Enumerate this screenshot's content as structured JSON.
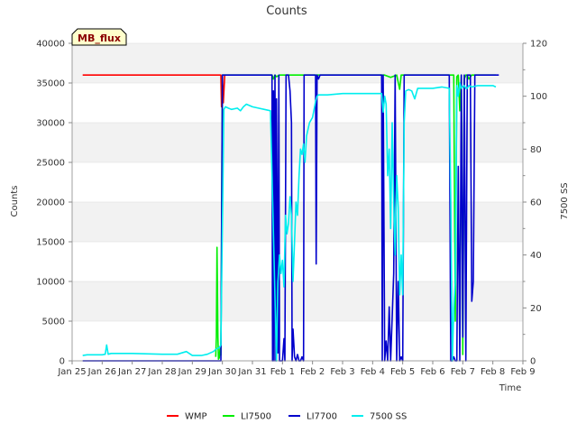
{
  "chart_data": {
    "type": "line",
    "title": "Counts",
    "xlabel": "Time",
    "ylabel": "Counts",
    "y2label": "7500 SS",
    "site_tag": "MB_flux",
    "x_ticks": [
      "Jan 25",
      "Jan 26",
      "Jan 27",
      "Jan 28",
      "Jan 29",
      "Jan 30",
      "Jan 31",
      "Feb 1",
      "Feb 2",
      "Feb 3",
      "Feb 4",
      "Feb 5",
      "Feb 6",
      "Feb 7",
      "Feb 8",
      "Feb 9"
    ],
    "xlim": [
      0,
      15
    ],
    "ylim": [
      0,
      40000
    ],
    "y_ticks": [
      0,
      5000,
      10000,
      15000,
      20000,
      25000,
      30000,
      35000,
      40000
    ],
    "y2lim": [
      0,
      120
    ],
    "y2_ticks": [
      0,
      20,
      40,
      60,
      80,
      100,
      120
    ],
    "legend_position": "bottom",
    "colors": {
      "band": "#f2f2f2",
      "grid": "#dcdcdc",
      "axis": "#888888"
    },
    "series": [
      {
        "name": "WMP",
        "color": "#ff0000",
        "axis": "left",
        "x": [
          0.35,
          4.95,
          4.97,
          5.0,
          5.03,
          5.08
        ],
        "y": [
          36000,
          36000,
          32000,
          36000,
          32500,
          36000
        ]
      },
      {
        "name": "LI7500",
        "color": "#00ee00",
        "axis": "left",
        "x": [
          4.78,
          4.8,
          4.82,
          4.85,
          4.87,
          4.9,
          4.92,
          4.95,
          5.0,
          5.05,
          5.1,
          6.65,
          6.7,
          6.75,
          6.8,
          6.9,
          7.2,
          10.4,
          10.6,
          10.8,
          10.9,
          10.95,
          11.0,
          12.7,
          12.75,
          12.8,
          12.85,
          12.9,
          12.95,
          13.0,
          13.05,
          13.1,
          13.15,
          13.2,
          13.3,
          13.5,
          14.1
        ],
        "y": [
          500,
          3000,
          14300,
          3000,
          200,
          400,
          1500,
          700,
          36000,
          36000,
          36000,
          36000,
          35500,
          36000,
          35800,
          36000,
          36000,
          36000,
          35700,
          36000,
          34200,
          36000,
          36000,
          36000,
          5000,
          35800,
          36000,
          31500,
          36000,
          800,
          35500,
          36000,
          36000,
          35500,
          36000,
          36000,
          36000
        ]
      },
      {
        "name": "LI7700",
        "color": "#0000cc",
        "axis": "left",
        "x": [
          0.35,
          4.95,
          5.0,
          5.05,
          5.1,
          5.15,
          6.65,
          6.67,
          6.7,
          6.72,
          6.75,
          6.78,
          6.8,
          6.85,
          6.88,
          6.9,
          7.0,
          7.05,
          7.08,
          7.12,
          7.2,
          7.25,
          7.3,
          7.32,
          7.35,
          7.4,
          7.45,
          7.5,
          7.55,
          7.6,
          7.65,
          7.7,
          7.72,
          7.75,
          7.8,
          8.1,
          8.12,
          8.15,
          8.2,
          8.25,
          8.3,
          10.3,
          10.32,
          10.35,
          10.4,
          10.45,
          10.5,
          10.55,
          10.6,
          10.7,
          10.75,
          10.8,
          10.85,
          10.9,
          10.95,
          11.0,
          11.05,
          11.1,
          11.15,
          11.2,
          12.55,
          12.6,
          12.65,
          12.7,
          12.75,
          12.8,
          12.85,
          12.9,
          12.95,
          13.0,
          13.05,
          13.1,
          13.15,
          13.2,
          13.25,
          13.3,
          13.35,
          13.4,
          13.45,
          13.5,
          13.55,
          13.6,
          14.2
        ],
        "y": [
          0,
          0,
          36000,
          36000,
          36000,
          36000,
          36000,
          0,
          34000,
          0,
          36000,
          0,
          33000,
          1000,
          36000,
          0,
          0,
          2800,
          0,
          36000,
          36000,
          34000,
          30000,
          0,
          4000,
          500,
          0,
          800,
          0,
          0,
          500,
          0,
          36000,
          36000,
          36000,
          36000,
          12200,
          36000,
          35500,
          36000,
          36000,
          36000,
          0,
          36000,
          0,
          2500,
          0,
          6800,
          0,
          11000,
          36000,
          0,
          10000,
          0,
          500,
          0,
          36000,
          36000,
          36000,
          36000,
          36000,
          0,
          0,
          500,
          0,
          0,
          24500,
          0,
          36000,
          3000,
          36000,
          0,
          36000,
          36000,
          36000,
          7500,
          10000,
          36000,
          36000,
          36000,
          36000,
          36000,
          36000
        ]
      },
      {
        "name": "7500 SS",
        "color": "#00eeee",
        "axis": "right",
        "x": [
          0.35,
          0.5,
          1.0,
          1.1,
          1.15,
          1.2,
          1.3,
          2.0,
          3.0,
          3.5,
          3.8,
          4.0,
          4.3,
          4.5,
          4.6,
          4.7,
          4.75,
          4.8,
          4.9,
          4.95,
          5.05,
          5.1,
          5.2,
          5.3,
          5.5,
          5.6,
          5.7,
          5.8,
          6.0,
          6.2,
          6.4,
          6.6,
          6.8,
          6.85,
          6.9,
          6.95,
          7.0,
          7.05,
          7.1,
          7.15,
          7.2,
          7.25,
          7.3,
          7.35,
          7.4,
          7.45,
          7.5,
          7.55,
          7.6,
          7.65,
          7.7,
          7.75,
          7.8,
          7.9,
          8.0,
          8.1,
          8.15,
          8.2,
          8.3,
          8.5,
          9.0,
          9.5,
          10.0,
          10.3,
          10.35,
          10.4,
          10.45,
          10.5,
          10.55,
          10.6,
          10.65,
          10.7,
          10.75,
          10.8,
          10.85,
          10.9,
          10.95,
          11.0,
          11.05,
          11.1,
          11.2,
          11.3,
          11.4,
          11.5,
          11.7,
          12.0,
          12.3,
          12.55,
          12.6,
          12.65,
          12.7,
          12.75,
          12.8,
          12.85,
          12.9,
          12.95,
          13.0,
          13.05,
          13.1,
          13.15,
          13.2,
          13.3,
          13.5,
          14.0,
          14.1
        ],
        "y": [
          2,
          2.3,
          2.3,
          2.5,
          6,
          2.5,
          2.8,
          2.8,
          2.5,
          2.5,
          3.5,
          2,
          2,
          2.5,
          3,
          3.5,
          4,
          4.5,
          5,
          6,
          95,
          96,
          95.5,
          95,
          95.5,
          94.5,
          96,
          97,
          96,
          95.5,
          95,
          94.5,
          0,
          30,
          40,
          33,
          38,
          28,
          55,
          48,
          52,
          62,
          55,
          30,
          45,
          60,
          55,
          70,
          80,
          78,
          82,
          75,
          85,
          90,
          92,
          98,
          100,
          100.5,
          100.5,
          100.5,
          101,
          101,
          101,
          101,
          94,
          100,
          97,
          70,
          80,
          50,
          90,
          60,
          40,
          70,
          58,
          25,
          40,
          25,
          90,
          102,
          102.5,
          102,
          99,
          103,
          103,
          103,
          103.5,
          103,
          60,
          0,
          20,
          30,
          104,
          100,
          105,
          103,
          103.5,
          104,
          103,
          103,
          104,
          103.5,
          104,
          104,
          103.5
        ]
      }
    ]
  }
}
